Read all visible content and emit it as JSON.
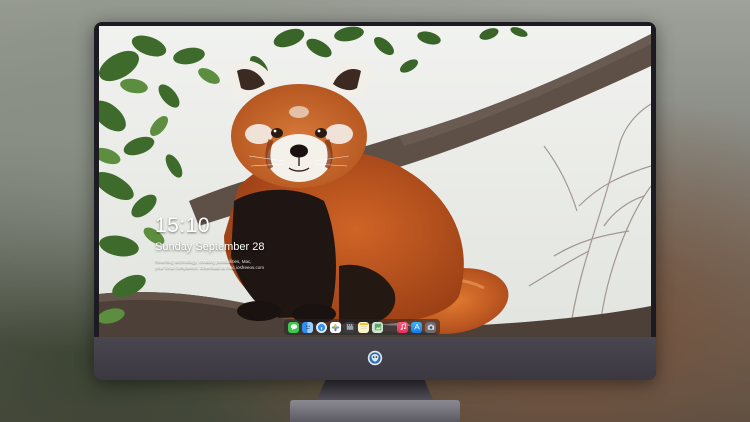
{
  "lock_screen": {
    "time": "15:10",
    "date": "Sunday September 28",
    "note_line1": "Rewriting technology, creating possibilities, Mac,",
    "note_line2": "your local companion. Download at mac.iosfreeos.com"
  },
  "dock": {
    "items": [
      {
        "name": "messages-icon",
        "color": "#3fc64f"
      },
      {
        "name": "finder-icon",
        "color": "#2f8ff0"
      },
      {
        "name": "safari-icon",
        "color": "#e8e8e8"
      },
      {
        "name": "photos-icon",
        "color": "#f3c24a"
      },
      {
        "name": "clapperboard-icon",
        "color": "#4a4a4a"
      },
      {
        "name": "notes-icon",
        "color": "#f7e27a"
      },
      {
        "name": "preview-icon",
        "color": "#5aa56b"
      },
      {
        "name": "music-icon",
        "color": "#f2487a"
      },
      {
        "name": "app-store-icon",
        "color": "#2d9bf0"
      },
      {
        "name": "camera-icon",
        "color": "#6d6d72"
      }
    ]
  },
  "colors": {
    "monitor_bezel": "#1d1b22",
    "chin": "#45414a",
    "panda_fur": "#c2561f"
  }
}
